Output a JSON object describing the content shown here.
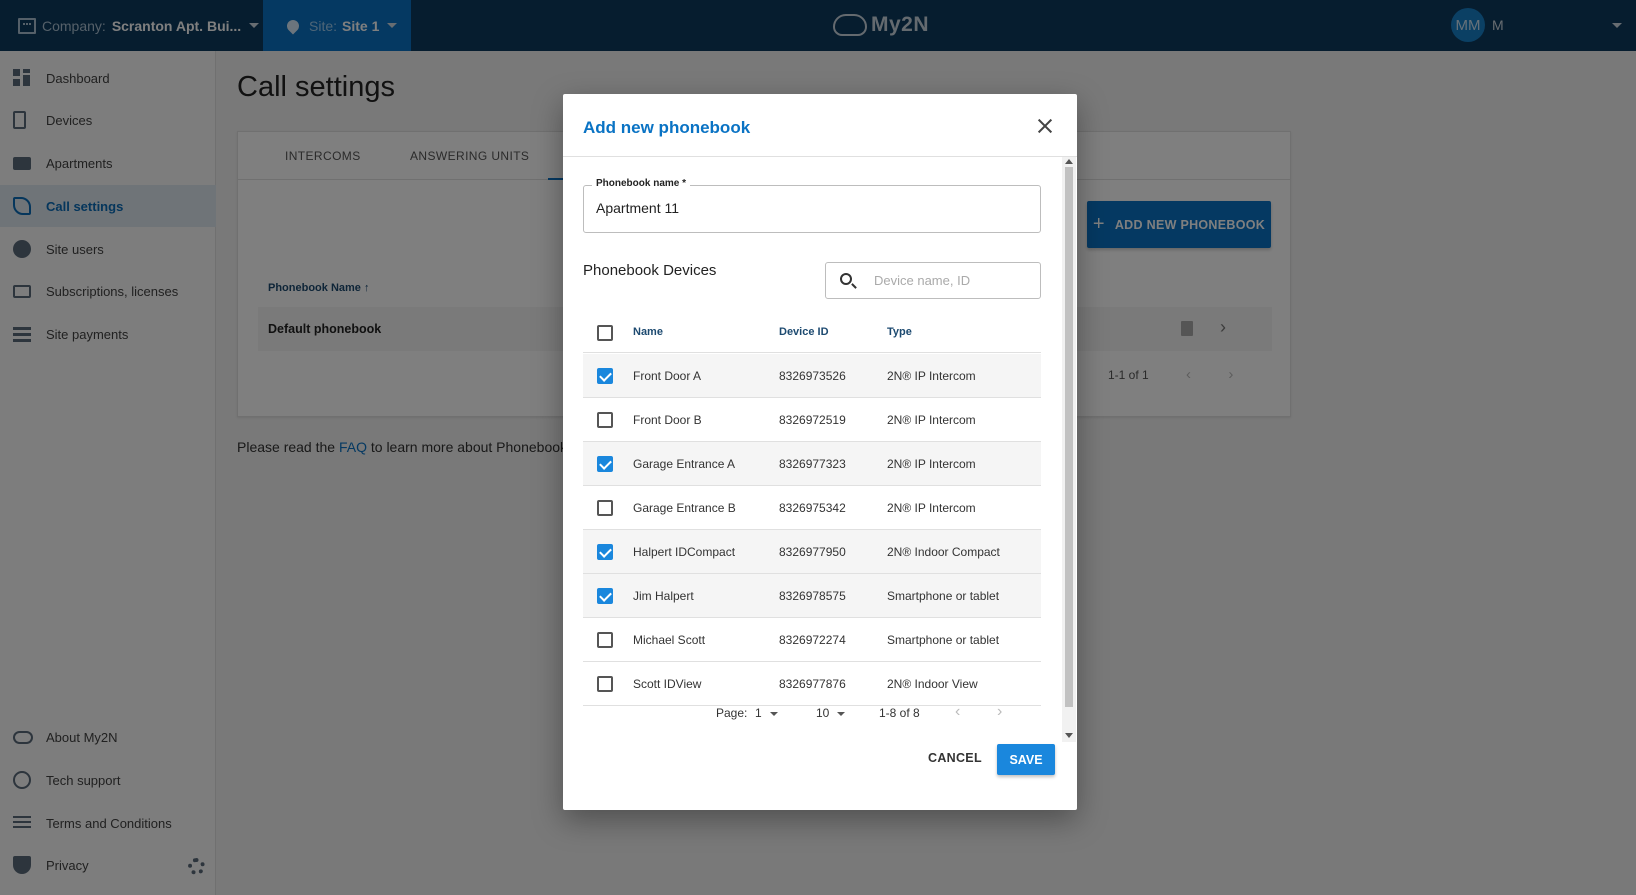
{
  "topbar": {
    "company_label": "Company:",
    "company_value": "Scranton Apt. Bui...",
    "site_label": "Site:",
    "site_value": "Site 1",
    "logo": "My2N",
    "avatar_initials": "MM",
    "user_initial": "M"
  },
  "sidebar": {
    "items": [
      {
        "label": "Dashboard",
        "icon": "dashboard-icon"
      },
      {
        "label": "Devices",
        "icon": "devices-icon"
      },
      {
        "label": "Apartments",
        "icon": "apartments-icon"
      },
      {
        "label": "Call settings",
        "icon": "call-settings-icon",
        "active": true
      },
      {
        "label": "Site users",
        "icon": "site-users-icon"
      },
      {
        "label": "Subscriptions, licenses",
        "icon": "subscriptions-icon"
      },
      {
        "label": "Site payments",
        "icon": "site-payments-icon"
      }
    ],
    "footer_items": [
      {
        "label": "About My2N",
        "icon": "cloud-icon"
      },
      {
        "label": "Tech support",
        "icon": "support-icon"
      },
      {
        "label": "Terms and Conditions",
        "icon": "terms-icon"
      },
      {
        "label": "Privacy",
        "icon": "shield-icon"
      }
    ]
  },
  "main": {
    "title": "Call settings",
    "tabs": [
      "INTERCOMS",
      "ANSWERING UNITS"
    ],
    "add_button": "ADD NEW PHONEBOOK",
    "column_header": "Phonebook Name ↑",
    "rows": [
      {
        "name": "Default phonebook"
      }
    ],
    "pagination": "1-1 of 1",
    "faq_prefix": "Please read the ",
    "faq_link": "FAQ",
    "faq_suffix": " to learn more about Phonebooks"
  },
  "dialog": {
    "title": "Add new phonebook",
    "name_label": "Phonebook name *",
    "name_value": "Apartment 11",
    "devices_title": "Phonebook Devices",
    "search_placeholder": "Device name, ID",
    "columns": {
      "name": "Name",
      "device_id": "Device ID",
      "type": "Type"
    },
    "devices": [
      {
        "name": "Front Door A",
        "id": "8326973526",
        "type": "2N® IP Intercom",
        "checked": true
      },
      {
        "name": "Front Door B",
        "id": "8326972519",
        "type": "2N® IP Intercom",
        "checked": false
      },
      {
        "name": "Garage Entrance A",
        "id": "8326977323",
        "type": "2N® IP Intercom",
        "checked": true
      },
      {
        "name": "Garage Entrance B",
        "id": "8326975342",
        "type": "2N® IP Intercom",
        "checked": false
      },
      {
        "name": "Halpert IDCompact",
        "id": "8326977950",
        "type": "2N® Indoor Compact",
        "checked": true
      },
      {
        "name": "Jim Halpert",
        "id": "8326978575",
        "type": "Smartphone or tablet",
        "checked": true
      },
      {
        "name": "Michael Scott",
        "id": "8326972274",
        "type": "Smartphone or tablet",
        "checked": false
      },
      {
        "name": "Scott IDView",
        "id": "8326977876",
        "type": "2N® Indoor View",
        "checked": false
      }
    ],
    "pager": {
      "page_label": "Page:",
      "page": "1",
      "per_page": "10",
      "range": "1-8 of 8"
    },
    "cancel": "CANCEL",
    "save": "SAVE"
  },
  "colors": {
    "topbar": "#0c3a5e",
    "accent": "#0a73c4",
    "checkbox": "#1a87dd"
  }
}
